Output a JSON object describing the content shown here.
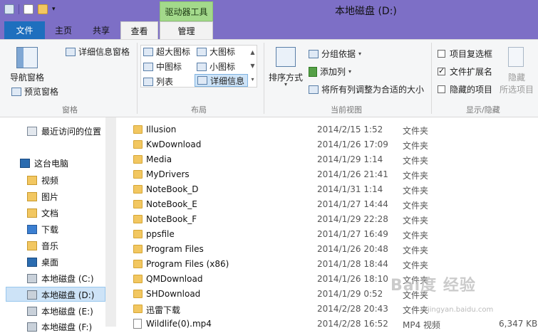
{
  "title_bar": {
    "window_title": "本地磁盘 (D:)",
    "context_tab_title": "驱动器工具"
  },
  "tabs": [
    "文件",
    "主页",
    "共享",
    "查看",
    "管理"
  ],
  "ribbon": {
    "panes": {
      "nav_pane": "导航窗格",
      "preview_pane": "预览窗格",
      "details_pane": "详细信息窗格",
      "group": "窗格"
    },
    "layout": {
      "xlarge_icons": "超大图标",
      "large_icons": "大图标",
      "medium_icons": "中图标",
      "small_icons": "小图标",
      "list": "列表",
      "details": "详细信息",
      "group": "布局"
    },
    "current_view": {
      "sort_by": "排序方式",
      "group_by": "分组依据",
      "add_columns": "添加列",
      "size_all_columns": "将所有列调整为合适的大小",
      "group": "当前视图"
    },
    "show_hide": {
      "item_checkboxes": "项目复选框",
      "item_checkboxes_checked": false,
      "file_extensions": "文件扩展名",
      "file_extensions_checked": true,
      "hidden_items": "隐藏的项目",
      "hidden_items_checked": false,
      "hide": "隐藏",
      "hide_selected": "所选项目",
      "group": "显示/隐藏"
    }
  },
  "nav": {
    "recent": "最近访问的位置",
    "this_pc": "这台电脑",
    "items": [
      "视频",
      "图片",
      "文档",
      "下载",
      "音乐",
      "桌面"
    ],
    "drives": [
      "本地磁盘 (C:)",
      "本地磁盘 (D:)",
      "本地磁盘 (E:)",
      "本地磁盘 (F:)"
    ]
  },
  "files": [
    {
      "name": "Illusion",
      "date": "2014/2/15 1:52",
      "type": "文件夹",
      "size": ""
    },
    {
      "name": "KwDownload",
      "date": "2014/1/26 17:09",
      "type": "文件夹",
      "size": ""
    },
    {
      "name": "Media",
      "date": "2014/1/29 1:14",
      "type": "文件夹",
      "size": ""
    },
    {
      "name": "MyDrivers",
      "date": "2014/1/26 21:41",
      "type": "文件夹",
      "size": ""
    },
    {
      "name": "NoteBook_D",
      "date": "2014/1/31 1:14",
      "type": "文件夹",
      "size": ""
    },
    {
      "name": "NoteBook_E",
      "date": "2014/1/27 14:44",
      "type": "文件夹",
      "size": ""
    },
    {
      "name": "NoteBook_F",
      "date": "2014/1/29 22:28",
      "type": "文件夹",
      "size": ""
    },
    {
      "name": "ppsfile",
      "date": "2014/1/27 16:49",
      "type": "文件夹",
      "size": ""
    },
    {
      "name": "Program Files",
      "date": "2014/1/26 20:48",
      "type": "文件夹",
      "size": ""
    },
    {
      "name": "Program Files (x86)",
      "date": "2014/1/28 18:44",
      "type": "文件夹",
      "size": ""
    },
    {
      "name": "QMDownload",
      "date": "2014/1/26 18:10",
      "type": "文件夹",
      "size": ""
    },
    {
      "name": "SHDownload",
      "date": "2014/1/29 0:52",
      "type": "文件夹",
      "size": ""
    },
    {
      "name": "迅雷下载",
      "date": "2014/2/28 20:43",
      "type": "文件夹",
      "size": ""
    },
    {
      "name": "Wildlife(0).mp4",
      "date": "2014/2/28 16:52",
      "type": "MP4 视频",
      "size": "6,347 KB"
    }
  ],
  "watermark": {
    "brand": "Bai度 经验",
    "url": "jingyan.baidu.com"
  }
}
